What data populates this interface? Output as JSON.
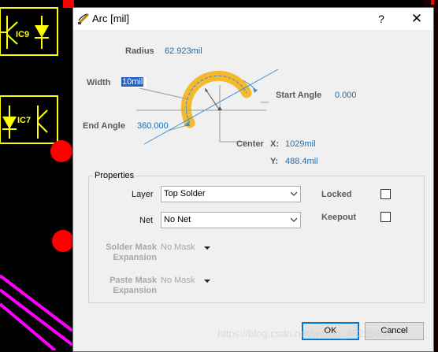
{
  "dialog": {
    "title": "Arc [mil]",
    "help_glyph": "?",
    "close_glyph": "✕"
  },
  "geometry": {
    "radius_label": "Radius",
    "radius_value": "62.923mil",
    "width_label": "Width",
    "width_value": "10mil",
    "start_angle_label": "Start Angle",
    "start_angle_value": "0.000",
    "end_angle_label": "End Angle",
    "end_angle_value": "360.000",
    "center_label": "Center",
    "x_label": "X:",
    "x_value": "1029mil",
    "y_label": "Y:",
    "y_value": "488.4mil"
  },
  "properties": {
    "group_title": "Properties",
    "layer_label": "Layer",
    "layer_value": "Top Solder",
    "net_label": "Net",
    "net_value": "No Net",
    "locked_label": "Locked",
    "locked_checked": false,
    "keepout_label": "Keepout",
    "keepout_checked": false,
    "solder_mask_label_1": "Solder Mask",
    "solder_mask_label_2": "Expansion",
    "solder_mask_value": "No Mask",
    "paste_mask_label_1": "Paste Mask",
    "paste_mask_label_2": "Expansion",
    "paste_mask_value": "No Mask"
  },
  "buttons": {
    "ok": "OK",
    "cancel": "Cancel"
  },
  "background": {
    "designators": [
      "IC9",
      "IC7"
    ],
    "watermark": "https://blog.csdn.net/weixin_45226664"
  },
  "colors": {
    "arc_fill": "#f5b82e",
    "dimension_line": "#3a8fd1",
    "value_text": "#1a6fb5",
    "pcb_yellow": "#ffff00",
    "pcb_red": "#ff0000",
    "pcb_magenta": "#ff00ff"
  },
  "icons": [
    "arc-tool-icon",
    "help-icon",
    "close-icon",
    "chevron-down-icon",
    "dropdown-arrow-icon"
  ]
}
